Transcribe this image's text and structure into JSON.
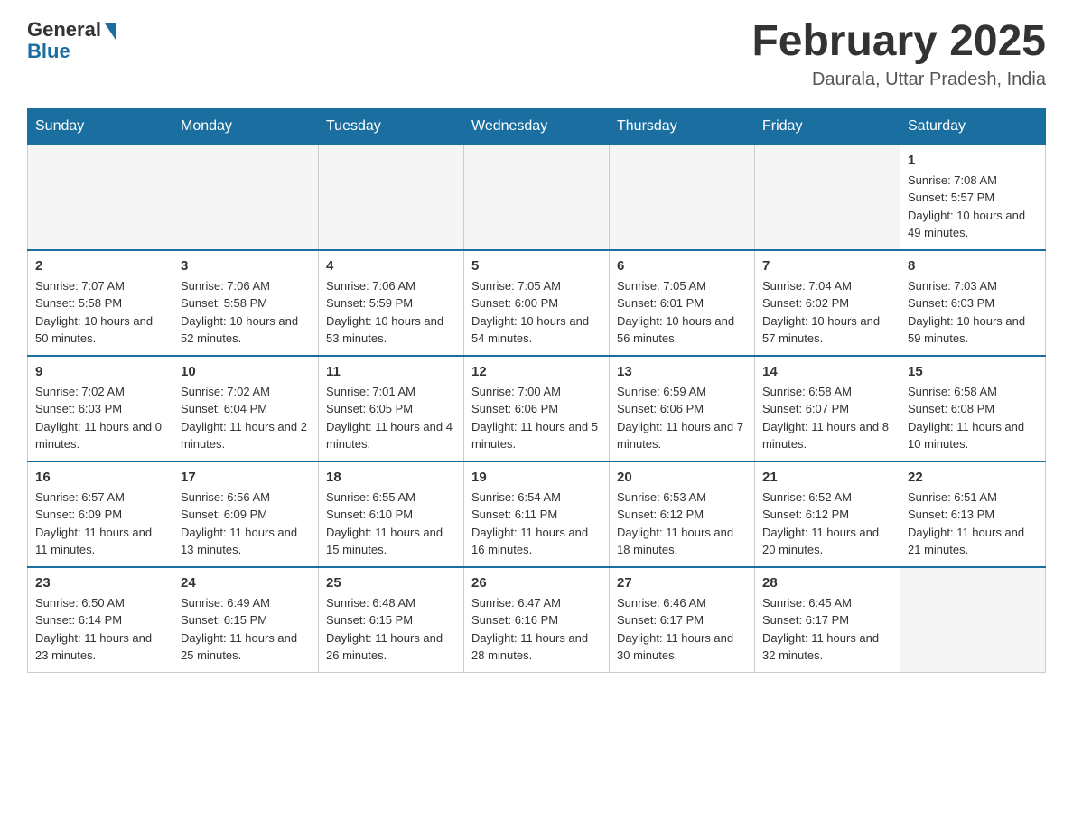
{
  "header": {
    "logo_general": "General",
    "logo_blue": "Blue",
    "month_title": "February 2025",
    "location": "Daurala, Uttar Pradesh, India"
  },
  "weekdays": [
    "Sunday",
    "Monday",
    "Tuesday",
    "Wednesday",
    "Thursday",
    "Friday",
    "Saturday"
  ],
  "weeks": [
    [
      {
        "day": "",
        "info": ""
      },
      {
        "day": "",
        "info": ""
      },
      {
        "day": "",
        "info": ""
      },
      {
        "day": "",
        "info": ""
      },
      {
        "day": "",
        "info": ""
      },
      {
        "day": "",
        "info": ""
      },
      {
        "day": "1",
        "info": "Sunrise: 7:08 AM\nSunset: 5:57 PM\nDaylight: 10 hours and 49 minutes."
      }
    ],
    [
      {
        "day": "2",
        "info": "Sunrise: 7:07 AM\nSunset: 5:58 PM\nDaylight: 10 hours and 50 minutes."
      },
      {
        "day": "3",
        "info": "Sunrise: 7:06 AM\nSunset: 5:58 PM\nDaylight: 10 hours and 52 minutes."
      },
      {
        "day": "4",
        "info": "Sunrise: 7:06 AM\nSunset: 5:59 PM\nDaylight: 10 hours and 53 minutes."
      },
      {
        "day": "5",
        "info": "Sunrise: 7:05 AM\nSunset: 6:00 PM\nDaylight: 10 hours and 54 minutes."
      },
      {
        "day": "6",
        "info": "Sunrise: 7:05 AM\nSunset: 6:01 PM\nDaylight: 10 hours and 56 minutes."
      },
      {
        "day": "7",
        "info": "Sunrise: 7:04 AM\nSunset: 6:02 PM\nDaylight: 10 hours and 57 minutes."
      },
      {
        "day": "8",
        "info": "Sunrise: 7:03 AM\nSunset: 6:03 PM\nDaylight: 10 hours and 59 minutes."
      }
    ],
    [
      {
        "day": "9",
        "info": "Sunrise: 7:02 AM\nSunset: 6:03 PM\nDaylight: 11 hours and 0 minutes."
      },
      {
        "day": "10",
        "info": "Sunrise: 7:02 AM\nSunset: 6:04 PM\nDaylight: 11 hours and 2 minutes."
      },
      {
        "day": "11",
        "info": "Sunrise: 7:01 AM\nSunset: 6:05 PM\nDaylight: 11 hours and 4 minutes."
      },
      {
        "day": "12",
        "info": "Sunrise: 7:00 AM\nSunset: 6:06 PM\nDaylight: 11 hours and 5 minutes."
      },
      {
        "day": "13",
        "info": "Sunrise: 6:59 AM\nSunset: 6:06 PM\nDaylight: 11 hours and 7 minutes."
      },
      {
        "day": "14",
        "info": "Sunrise: 6:58 AM\nSunset: 6:07 PM\nDaylight: 11 hours and 8 minutes."
      },
      {
        "day": "15",
        "info": "Sunrise: 6:58 AM\nSunset: 6:08 PM\nDaylight: 11 hours and 10 minutes."
      }
    ],
    [
      {
        "day": "16",
        "info": "Sunrise: 6:57 AM\nSunset: 6:09 PM\nDaylight: 11 hours and 11 minutes."
      },
      {
        "day": "17",
        "info": "Sunrise: 6:56 AM\nSunset: 6:09 PM\nDaylight: 11 hours and 13 minutes."
      },
      {
        "day": "18",
        "info": "Sunrise: 6:55 AM\nSunset: 6:10 PM\nDaylight: 11 hours and 15 minutes."
      },
      {
        "day": "19",
        "info": "Sunrise: 6:54 AM\nSunset: 6:11 PM\nDaylight: 11 hours and 16 minutes."
      },
      {
        "day": "20",
        "info": "Sunrise: 6:53 AM\nSunset: 6:12 PM\nDaylight: 11 hours and 18 minutes."
      },
      {
        "day": "21",
        "info": "Sunrise: 6:52 AM\nSunset: 6:12 PM\nDaylight: 11 hours and 20 minutes."
      },
      {
        "day": "22",
        "info": "Sunrise: 6:51 AM\nSunset: 6:13 PM\nDaylight: 11 hours and 21 minutes."
      }
    ],
    [
      {
        "day": "23",
        "info": "Sunrise: 6:50 AM\nSunset: 6:14 PM\nDaylight: 11 hours and 23 minutes."
      },
      {
        "day": "24",
        "info": "Sunrise: 6:49 AM\nSunset: 6:15 PM\nDaylight: 11 hours and 25 minutes."
      },
      {
        "day": "25",
        "info": "Sunrise: 6:48 AM\nSunset: 6:15 PM\nDaylight: 11 hours and 26 minutes."
      },
      {
        "day": "26",
        "info": "Sunrise: 6:47 AM\nSunset: 6:16 PM\nDaylight: 11 hours and 28 minutes."
      },
      {
        "day": "27",
        "info": "Sunrise: 6:46 AM\nSunset: 6:17 PM\nDaylight: 11 hours and 30 minutes."
      },
      {
        "day": "28",
        "info": "Sunrise: 6:45 AM\nSunset: 6:17 PM\nDaylight: 11 hours and 32 minutes."
      },
      {
        "day": "",
        "info": ""
      }
    ]
  ]
}
